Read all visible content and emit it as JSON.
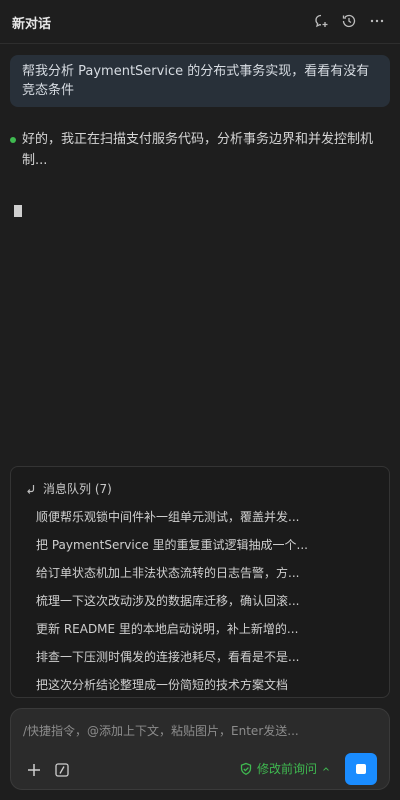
{
  "header": {
    "title": "新对话",
    "icons": [
      "new-chat-icon",
      "history-icon",
      "more-icon"
    ]
  },
  "user_message": "帮我分析 PaymentService 的分布式事务实现，看看有没有竞态条件",
  "assistant_message": "好的，我正在扫描支付服务代码，分析事务边界和并发控制机制...",
  "queue": {
    "title": "消息队列 (7)",
    "items": [
      "顺便帮乐观锁中间件补一组单元测试，覆盖并发...",
      "把 PaymentService 里的重复重试逻辑抽成一个...",
      "给订单状态机加上非法状态流转的日志告警，方...",
      "梳理一下这次改动涉及的数据库迁移，确认回滚...",
      "更新 README 里的本地启动说明，补上新增的...",
      "排查一下压测时偶发的连接池耗尽，看看是不是...",
      "把这次分析结论整理成一份简短的技术方案文档"
    ]
  },
  "input": {
    "placeholder": "/快捷指令，@添加上下文，粘贴图片，Enter发送...",
    "mode_label": "修改前询问"
  },
  "colors": {
    "accent_blue": "#1a8cff",
    "status_green": "#3fb950"
  }
}
